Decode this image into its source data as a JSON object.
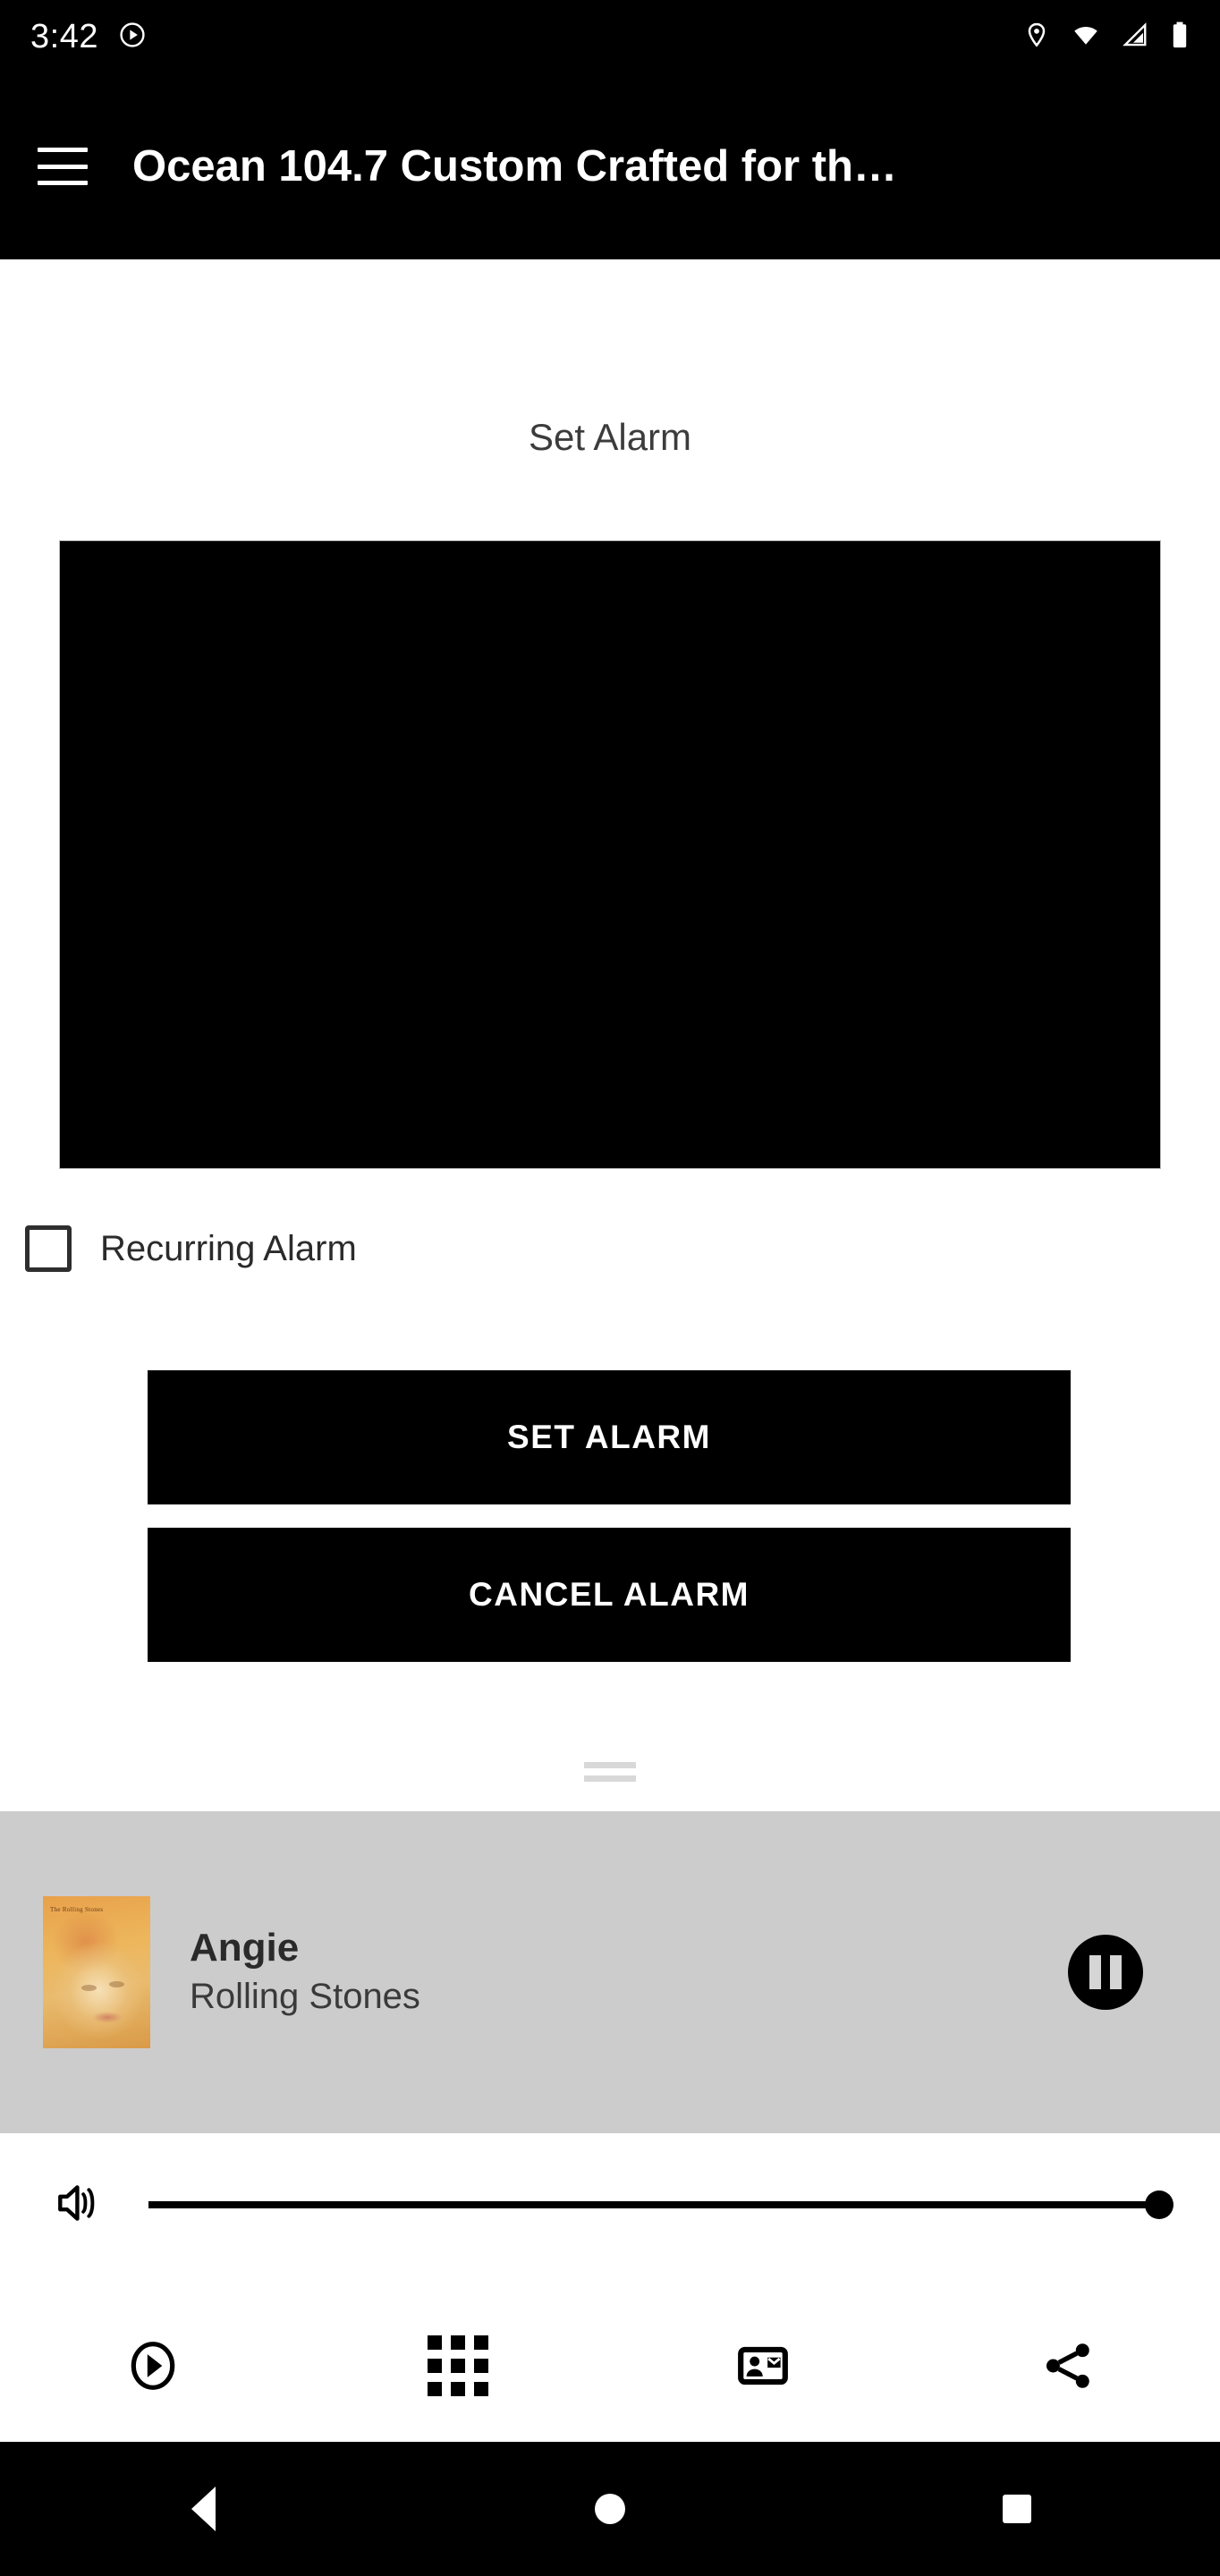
{
  "status_bar": {
    "time": "3:42",
    "left_icons": [
      {
        "name": "play-circle-icon"
      }
    ],
    "right_icons": [
      {
        "name": "location-pin-icon"
      },
      {
        "name": "wifi-icon"
      },
      {
        "name": "cell-signal-icon"
      },
      {
        "name": "battery-icon"
      }
    ]
  },
  "app_bar": {
    "menu_icon": "hamburger-menu-icon",
    "title": "Ocean 104.7 Custom Crafted for th…",
    "background": "#000000",
    "text_color": "#ffffff"
  },
  "main": {
    "heading": "Set Alarm",
    "time_picker": {
      "name": "time-picker",
      "background": "#000000",
      "value": ""
    },
    "recurring": {
      "label": "Recurring Alarm",
      "checked": false
    },
    "buttons": [
      {
        "label": "SET ALARM",
        "name": "set-alarm-button"
      },
      {
        "label": "CANCEL ALARM",
        "name": "cancel-alarm-button"
      }
    ],
    "drag_handle": "sheet-drag-handle"
  },
  "now_playing": {
    "background": "#cccccc",
    "album_art_label": "The Rolling Stones",
    "title": "Angie",
    "artist": "Rolling Stones",
    "transport_icon": "pause-icon",
    "is_playing": true
  },
  "volume": {
    "icon": "volume-up-icon",
    "level": 100
  },
  "toolbar": {
    "items": [
      {
        "name": "play-circle-icon",
        "label": "Play"
      },
      {
        "name": "grid-apps-icon",
        "label": "Browse"
      },
      {
        "name": "contact-card-icon",
        "label": "Contact"
      },
      {
        "name": "share-icon",
        "label": "Share"
      }
    ]
  },
  "nav_bar": {
    "items": [
      {
        "name": "nav-back-button",
        "label": "Back"
      },
      {
        "name": "nav-home-button",
        "label": "Home"
      },
      {
        "name": "nav-recents-button",
        "label": "Recents"
      }
    ],
    "background": "#000000"
  },
  "colors": {
    "accent": "#000000",
    "panel": "#cccccc",
    "page": "#ffffff"
  }
}
